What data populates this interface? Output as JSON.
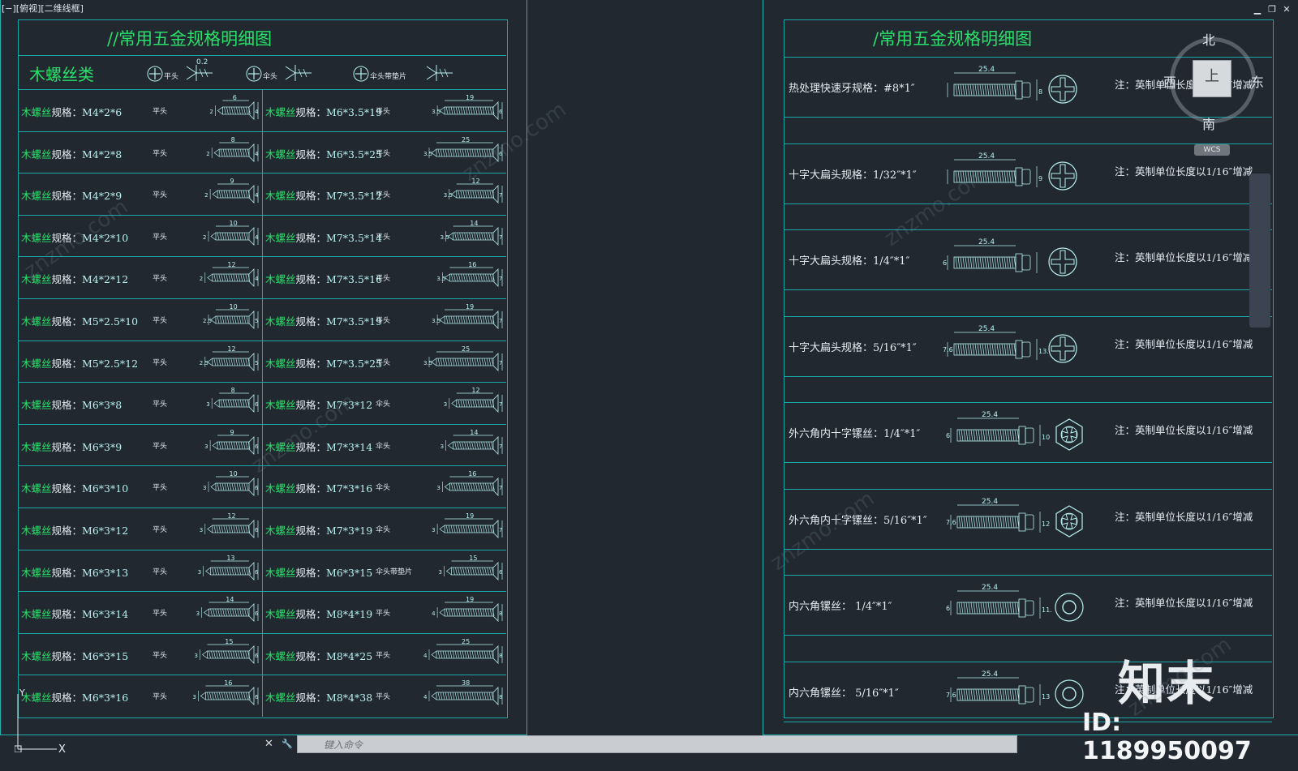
{
  "viewport": {
    "label": "[−][俯视][二维线框]"
  },
  "window_controls": {
    "minimize": "▁",
    "restore": "❐",
    "close": "✕"
  },
  "left_sheet": {
    "title": "//常用五金规格明细图",
    "section_title": "木螺丝类",
    "head_types": [
      {
        "label": "平头",
        "dim": "0.2"
      },
      {
        "label": "伞头",
        "dim": ""
      },
      {
        "label": "伞头带垫片",
        "dim": ""
      }
    ],
    "rows_left": [
      {
        "prefix": "木螺丝",
        "mid": "规格：",
        "spec": "M4*2*6",
        "head": "平头",
        "len": "6",
        "dia": "2",
        "hd": "4"
      },
      {
        "prefix": "木螺丝",
        "mid": "规格：",
        "spec": "M4*2*8",
        "head": "平头",
        "len": "8",
        "dia": "2",
        "hd": "4"
      },
      {
        "prefix": "木螺丝",
        "mid": "规格：",
        "spec": "M4*2*9",
        "head": "平头",
        "len": "9",
        "dia": "2",
        "hd": "4"
      },
      {
        "prefix": "木螺丝",
        "mid": "规格：",
        "spec": "M4*2*10",
        "head": "平头",
        "len": "10",
        "dia": "2",
        "hd": "4"
      },
      {
        "prefix": "木螺丝",
        "mid": "规格：",
        "spec": "M4*2*12",
        "head": "平头",
        "len": "12",
        "dia": "2",
        "hd": "4"
      },
      {
        "prefix": "木螺丝",
        "mid": "规格：",
        "spec": "M5*2.5*10",
        "head": "平头",
        "len": "10",
        "dia": "2.5",
        "hd": "5"
      },
      {
        "prefix": "木螺丝",
        "mid": "规格：",
        "spec": "M5*2.5*12",
        "head": "平头",
        "len": "12",
        "dia": "2.5",
        "hd": "5"
      },
      {
        "prefix": "木螺丝",
        "mid": "规格：",
        "spec": "M6*3*8",
        "head": "平头",
        "len": "8",
        "dia": "3",
        "hd": "6"
      },
      {
        "prefix": "木螺丝",
        "mid": "规格：",
        "spec": "M6*3*9",
        "head": "平头",
        "len": "9",
        "dia": "3",
        "hd": "6"
      },
      {
        "prefix": "木螺丝",
        "mid": "规格：",
        "spec": "M6*3*10",
        "head": "平头",
        "len": "10",
        "dia": "3",
        "hd": "6"
      },
      {
        "prefix": "木螺丝",
        "mid": "规格：",
        "spec": "M6*3*12",
        "head": "平头",
        "len": "12",
        "dia": "3",
        "hd": "6"
      },
      {
        "prefix": "木螺丝",
        "mid": "规格：",
        "spec": "M6*3*13",
        "head": "平头",
        "len": "13",
        "dia": "3",
        "hd": "6"
      },
      {
        "prefix": "木螺丝",
        "mid": "规格：",
        "spec": "M6*3*14",
        "head": "平头",
        "len": "14",
        "dia": "3",
        "hd": "6"
      },
      {
        "prefix": "木螺丝",
        "mid": "规格：",
        "spec": "M6*3*15",
        "head": "平头",
        "len": "15",
        "dia": "3",
        "hd": "6"
      },
      {
        "prefix": "木螺丝",
        "mid": "规格：",
        "spec": "M6*3*16",
        "head": "平头",
        "len": "16",
        "dia": "3",
        "hd": "6"
      }
    ],
    "rows_right": [
      {
        "prefix": "木螺丝",
        "mid": "规格：",
        "spec": "M6*3.5*19",
        "head": "平头",
        "len": "19",
        "dia": "3.5",
        "hd": "6"
      },
      {
        "prefix": "木螺丝",
        "mid": "规格：",
        "spec": "M6*3.5*25",
        "head": "平头",
        "len": "25",
        "dia": "3.5",
        "hd": "6"
      },
      {
        "prefix": "木螺丝",
        "mid": "规格：",
        "spec": "M7*3.5*12",
        "head": "平头",
        "len": "12",
        "dia": "3.5",
        "hd": "7"
      },
      {
        "prefix": "木螺丝",
        "mid": "规格：",
        "spec": "M7*3.5*14",
        "head": "平头",
        "len": "14",
        "dia": "3.5",
        "hd": "7"
      },
      {
        "prefix": "木螺丝",
        "mid": "规格：",
        "spec": "M7*3.5*16",
        "head": "平头",
        "len": "16",
        "dia": "3.5",
        "hd": "7"
      },
      {
        "prefix": "木螺丝",
        "mid": "规格：",
        "spec": "M7*3.5*19",
        "head": "平头",
        "len": "19",
        "dia": "3.5",
        "hd": "7"
      },
      {
        "prefix": "木螺丝",
        "mid": "规格：",
        "spec": "M7*3.5*25",
        "head": "平头",
        "len": "25",
        "dia": "3.5",
        "hd": "7"
      },
      {
        "prefix": "木螺丝",
        "mid": "规格：",
        "spec": "M7*3*12",
        "head": "伞头",
        "len": "12",
        "dia": "3",
        "hd": "7"
      },
      {
        "prefix": "木螺丝",
        "mid": "规格：",
        "spec": "M7*3*14",
        "head": "伞头",
        "len": "14",
        "dia": "3",
        "hd": "7"
      },
      {
        "prefix": "木螺丝",
        "mid": "规格：",
        "spec": "M7*3*16",
        "head": "伞头",
        "len": "16",
        "dia": "3",
        "hd": "7"
      },
      {
        "prefix": "木螺丝",
        "mid": "规格：",
        "spec": "M7*3*19",
        "head": "伞头",
        "len": "19",
        "dia": "3",
        "hd": "7"
      },
      {
        "prefix": "木螺丝",
        "mid": "规格：",
        "spec": "M6*3*15",
        "head": "伞头带垫片",
        "len": "15",
        "dia": "3",
        "hd": "6"
      },
      {
        "prefix": "木螺丝",
        "mid": "规格：",
        "spec": "M8*4*19",
        "head": "平头",
        "len": "19",
        "dia": "4",
        "hd": "8"
      },
      {
        "prefix": "木螺丝",
        "mid": "规格：",
        "spec": "M8*4*25",
        "head": "平头",
        "len": "25",
        "dia": "4",
        "hd": "8"
      },
      {
        "prefix": "木螺丝",
        "mid": "规格：",
        "spec": "M8*4*38",
        "head": "平头",
        "len": "38",
        "dia": "4",
        "hd": "8"
      }
    ]
  },
  "right_sheet": {
    "title": "/常用五金规格明细图",
    "rows": [
      {
        "label": "热处理快速牙规格：#8*1″",
        "len": "25.4",
        "dia": "",
        "hd": "8",
        "icon": "cross",
        "note": "注：英制单位长度以1/16″增减"
      },
      {
        "label": "十字大扁头规格：1/32″*1″",
        "len": "25.4",
        "dia": "",
        "hd": "9",
        "icon": "cross",
        "note": "注：英制单位长度以1/16″增减"
      },
      {
        "label": "十字大扁头规格：1/4″*1″",
        "len": "25.4",
        "dia": "6",
        "hd": "",
        "icon": "cross",
        "note": "注：英制单位长度以1/16″增减"
      },
      {
        "label": "十字大扁头规格：5/16″*1″",
        "len": "25.4",
        "dia": "7.6",
        "hd": "13.5",
        "icon": "cross",
        "note": "注：英制单位长度以1/16″增减"
      },
      {
        "label": "外六角内十字镙丝：1/4″*1″",
        "len": "25.4",
        "dia": "6",
        "hd": "10",
        "icon": "hex",
        "note": "注：英制单位长度以1/16″增减"
      },
      {
        "label": "外六角内十字镙丝：5/16″*1″",
        "len": "25.4",
        "dia": "7.6",
        "hd": "12",
        "icon": "hex",
        "note": "注：英制单位长度以1/16″增减"
      },
      {
        "label": "内六角镙丝：    1/4″*1″",
        "len": "25.4",
        "dia": "6",
        "hd": "11.1",
        "icon": "circle",
        "note": "注：英制单位长度以1/16″增减"
      },
      {
        "label": "内六角镙丝：    5/16″*1″",
        "len": "25.4",
        "dia": "7.6",
        "hd": "13",
        "icon": "circle",
        "note": "注：英制单位长度以1/16″增减"
      }
    ]
  },
  "viewcube": {
    "north": "北",
    "south": "南",
    "east": "东",
    "west": "西",
    "face": "上",
    "wcs": "WCS"
  },
  "command_line": {
    "placeholder": "键入命令",
    "close": "✕",
    "tool": "🔧"
  },
  "overlay": {
    "logo": "知末",
    "id": "ID: 1189950097"
  },
  "watermark": "znzmo.com"
}
